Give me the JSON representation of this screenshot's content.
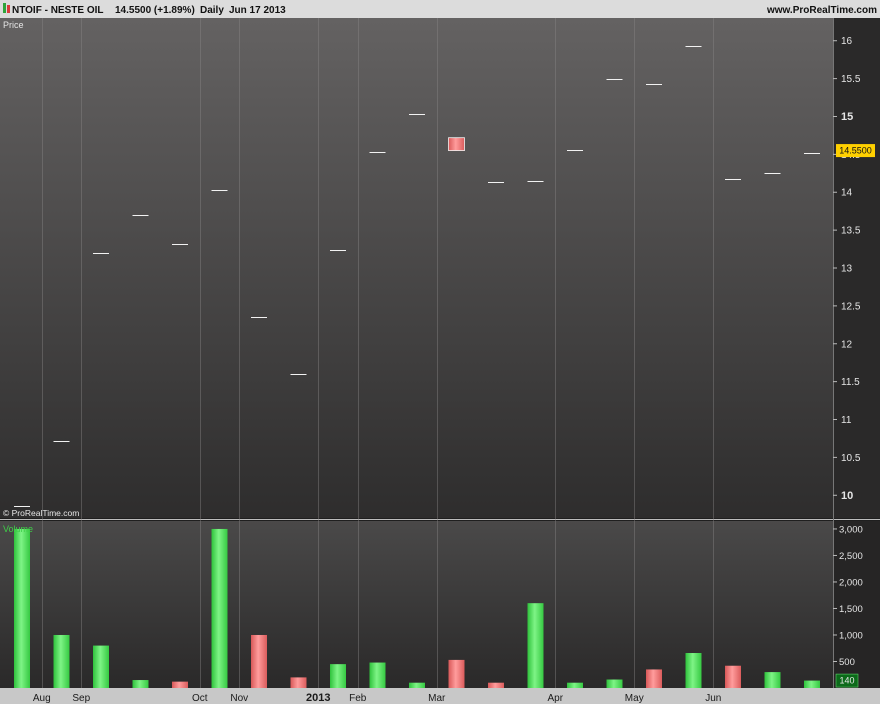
{
  "header": {
    "symbol_title": "NTOIF - NESTE OIL",
    "price_change": "14.5500 (+1.89%)",
    "period": "Daily",
    "date": "Jun 17 2013",
    "site": "www.ProRealTime.com"
  },
  "price_panel": {
    "label": "Price",
    "watermark": "© ProRealTime.com",
    "last_price": "14.5500",
    "last_price_value": 14.55
  },
  "volume_panel": {
    "label": "Volume",
    "last_volume": "140",
    "last_volume_value": 140
  },
  "colors": {
    "up": "#4fe05a",
    "down": "#f07878",
    "price_tag": "#ffd000",
    "volume_tag": "#0c6a1a"
  },
  "chart_data": [
    {
      "type": "candlestick",
      "y_axis": {
        "range": [
          9.7,
          16.3
        ],
        "ticks": [
          10,
          10.5,
          11,
          11.5,
          12,
          12.5,
          13,
          13.5,
          14,
          14.5,
          15,
          15.5,
          16
        ],
        "tick_labels": [
          "10",
          "10.5",
          "11",
          "11.5",
          "12",
          "12.5",
          "13",
          "13.5",
          "14",
          "14.5",
          "15",
          "15.5",
          "16"
        ],
        "bold_ticks": [
          10,
          15
        ]
      },
      "x_axis": {
        "labels": [
          "Aug",
          "Sep",
          "Oct",
          "Nov",
          "2013",
          "Feb",
          "Mar",
          "Apr",
          "May",
          "Jun"
        ],
        "label_bar_index": [
          1,
          2,
          5,
          6,
          8,
          9,
          11,
          14,
          16,
          18
        ],
        "bold_labels": [
          "2013"
        ]
      },
      "bars": [
        {
          "o": 9.86,
          "c": 9.86,
          "dir": "up"
        },
        {
          "o": 10.71,
          "c": 10.71,
          "dir": "up"
        },
        {
          "o": 13.2,
          "c": 13.2,
          "dir": "up"
        },
        {
          "o": 13.7,
          "c": 13.7,
          "dir": "up"
        },
        {
          "o": 13.32,
          "c": 13.32,
          "dir": "up"
        },
        {
          "o": 14.03,
          "c": 14.03,
          "dir": "up"
        },
        {
          "o": 12.35,
          "c": 12.35,
          "dir": "up"
        },
        {
          "o": 11.6,
          "c": 11.6,
          "dir": "up"
        },
        {
          "o": 13.24,
          "c": 13.24,
          "dir": "up"
        },
        {
          "o": 14.53,
          "c": 14.53,
          "dir": "up"
        },
        {
          "o": 15.03,
          "c": 15.03,
          "dir": "up"
        },
        {
          "o": 14.72,
          "c": 14.55,
          "dir": "down"
        },
        {
          "o": 14.13,
          "c": 14.13,
          "dir": "up"
        },
        {
          "o": 14.15,
          "c": 14.15,
          "dir": "up"
        },
        {
          "o": 14.56,
          "c": 14.56,
          "dir": "up"
        },
        {
          "o": 15.49,
          "c": 15.49,
          "dir": "up"
        },
        {
          "o": 15.43,
          "c": 15.43,
          "dir": "up"
        },
        {
          "o": 15.93,
          "c": 15.93,
          "dir": "up"
        },
        {
          "o": 14.18,
          "c": 14.18,
          "dir": "up"
        },
        {
          "o": 14.26,
          "c": 14.26,
          "dir": "up"
        },
        {
          "o": 14.52,
          "c": 14.52,
          "dir": "up"
        }
      ]
    },
    {
      "type": "bar",
      "y_axis": {
        "range": [
          0,
          3150
        ],
        "ticks": [
          500,
          1000,
          1500,
          2000,
          2500,
          3000
        ],
        "tick_labels": [
          "500",
          "1,000",
          "1,500",
          "2,000",
          "2,500",
          "3,000"
        ]
      },
      "values": [
        3000,
        1000,
        800,
        150,
        120,
        3000,
        1000,
        200,
        450,
        480,
        100,
        530,
        100,
        1600,
        100,
        160,
        350,
        660,
        420,
        300,
        140
      ],
      "directions": [
        "up",
        "up",
        "up",
        "up",
        "down",
        "up",
        "down",
        "down",
        "up",
        "up",
        "up",
        "down",
        "down",
        "up",
        "up",
        "up",
        "down",
        "up",
        "down",
        "up",
        "up"
      ]
    }
  ]
}
